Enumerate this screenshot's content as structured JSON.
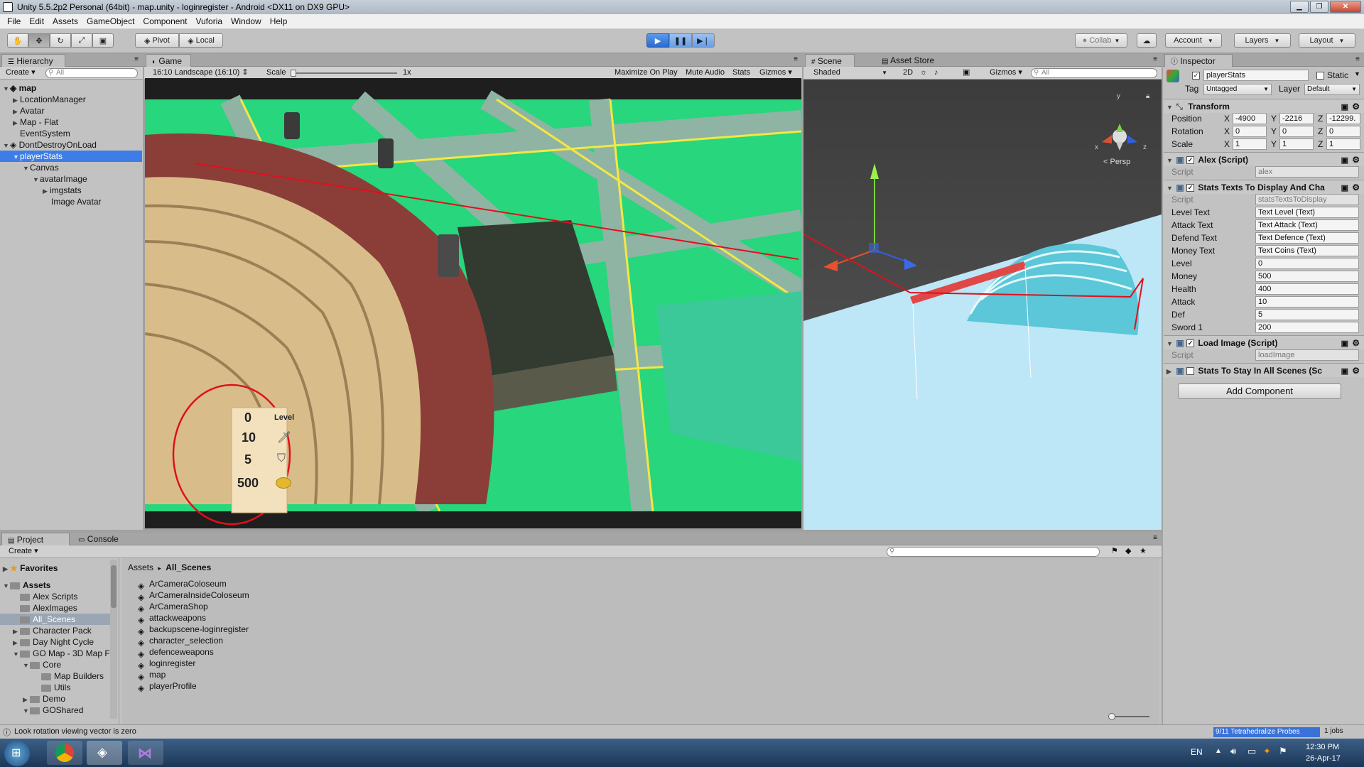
{
  "window": {
    "title": "Unity 5.5.2p2 Personal (64bit) - map.unity - loginregister - Android <DX11 on DX9 GPU>"
  },
  "menu": [
    "File",
    "Edit",
    "Assets",
    "GameObject",
    "Component",
    "Vuforia",
    "Window",
    "Help"
  ],
  "toolbar": {
    "pivot": "Pivot",
    "local": "Local",
    "collab": "Collab",
    "account": "Account",
    "layers": "Layers",
    "layout": "Layout"
  },
  "hierarchy": {
    "tab": "Hierarchy",
    "create": "Create",
    "search": "All",
    "items": [
      {
        "label": "map"
      },
      {
        "label": "LocationManager"
      },
      {
        "label": "Avatar"
      },
      {
        "label": "Map - Flat"
      },
      {
        "label": "EventSystem"
      },
      {
        "label": "DontDestroyOnLoad"
      },
      {
        "label": "playerStats"
      },
      {
        "label": "Canvas"
      },
      {
        "label": "avatarImage"
      },
      {
        "label": "imgstats"
      },
      {
        "label": "Image Avatar"
      }
    ]
  },
  "game": {
    "tab": "Game",
    "aspect": "16:10 Landscape (16:10)",
    "scale_label": "Scale",
    "scale_value": "1x",
    "maximize": "Maximize On Play",
    "mute": "Mute Audio",
    "stats": "Stats",
    "gizmos": "Gizmos",
    "stats_card": {
      "level_value": "0",
      "level_label": "Level",
      "attack_value": "10",
      "defence_value": "5",
      "coins_value": "500"
    }
  },
  "scene": {
    "tab": "Scene",
    "asset_store_tab": "Asset Store",
    "shading": "Shaded",
    "mode_2d": "2D",
    "gizmos": "Gizmos",
    "search": "All",
    "persp": "< Persp",
    "axis_x": "x",
    "axis_y": "y",
    "axis_z": "z"
  },
  "inspector": {
    "tab": "Inspector",
    "object_name": "playerStats",
    "static_label": "Static",
    "tag_label": "Tag",
    "tag_value": "Untagged",
    "layer_label": "Layer",
    "layer_value": "Default",
    "transform": {
      "title": "Transform",
      "position_label": "Position",
      "rotation_label": "Rotation",
      "scale_label": "Scale",
      "position": {
        "x": "-4900",
        "y": "-2216",
        "z": "-12299."
      },
      "rotation": {
        "x": "0",
        "y": "0",
        "z": "0"
      },
      "scale": {
        "x": "1",
        "y": "1",
        "z": "1"
      }
    },
    "alex_script": {
      "title": "Alex (Script)",
      "script_label": "Script",
      "script_value": "alex"
    },
    "stats_texts": {
      "title": "Stats Texts To Display And Cha",
      "fields": [
        {
          "label": "Script",
          "value": "statsTextsToDisplay"
        },
        {
          "label": "Level Text",
          "value": "Text Level (Text)"
        },
        {
          "label": "Attack Text",
          "value": "Text Attack (Text)"
        },
        {
          "label": "Defend Text",
          "value": "Text Defence (Text)"
        },
        {
          "label": "Money Text",
          "value": "Text Coins (Text)"
        },
        {
          "label": "Level",
          "value": "0"
        },
        {
          "label": "Money",
          "value": "500"
        },
        {
          "label": "Health",
          "value": "400"
        },
        {
          "label": "Attack",
          "value": "10"
        },
        {
          "label": "Def",
          "value": "5"
        },
        {
          "label": "Sword 1",
          "value": "200"
        }
      ]
    },
    "load_image": {
      "title": "Load Image (Script)",
      "script_label": "Script",
      "script_value": "loadImage"
    },
    "stats_stay": {
      "title": "Stats To Stay In All Scenes (Sc"
    },
    "add_component": "Add Component"
  },
  "project": {
    "tab": "Project",
    "console_tab": "Console",
    "create": "Create",
    "favorites": "Favorites",
    "assets": "Assets",
    "folders": [
      {
        "label": "Alex Scripts"
      },
      {
        "label": "AlexImages"
      },
      {
        "label": "All_Scenes"
      },
      {
        "label": "Character Pack"
      },
      {
        "label": "Day Night Cycle"
      },
      {
        "label": "GO Map - 3D Map F"
      },
      {
        "label": "Core"
      },
      {
        "label": "Map Builders"
      },
      {
        "label": "Utils"
      },
      {
        "label": "Demo"
      },
      {
        "label": "GOShared"
      }
    ],
    "breadcrumb_root": "Assets",
    "breadcrumb_current": "All_Scenes",
    "files": [
      "ArCameraColoseum",
      "ArCameraInsideColoseum",
      "ArCameraShop",
      "attackweapons",
      "backupscene-loginregister",
      "character_selection",
      "defenceweapons",
      "loginregister",
      "map",
      "playerProfile"
    ]
  },
  "status": {
    "message": "Look rotation viewing vector is zero",
    "probes": "9/11 Tetrahedralize Probes",
    "jobs": "1 jobs"
  },
  "taskbar": {
    "lang": "EN",
    "time": "12:30 PM",
    "date": "26-Apr-17"
  },
  "colors": {
    "selection": "#3e7de7",
    "annotation": "#e0101a",
    "map_green": "#27d67d",
    "road": "#8fb4a4",
    "road_line": "#f4e842",
    "scene_floor": "#bde6f6"
  }
}
